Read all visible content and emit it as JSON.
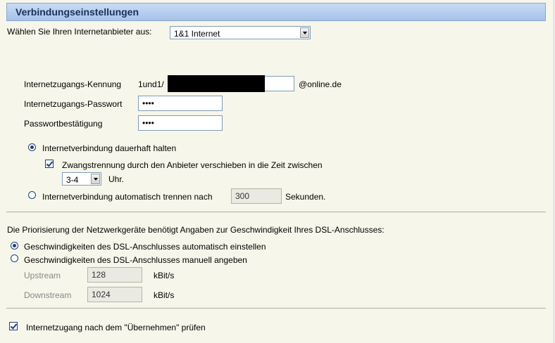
{
  "section": {
    "title": "Verbindungseinstellungen"
  },
  "provider": {
    "label": "Wählen Sie Ihren Internetanbieter aus:",
    "selected": "1&1 Internet"
  },
  "account": {
    "kennung_label": "Internetzugangs-Kennung",
    "kennung_prefix": "1und1/",
    "kennung_suffix": "@online.de",
    "passwort_label": "Internetzugangs-Passwort",
    "passwort_value": "••••",
    "bestaetigung_label": "Passwortbestätigung",
    "bestaetigung_value": "••••"
  },
  "connection": {
    "keep_label": "Internetverbindung dauerhaft halten",
    "shift_label": "Zwangstrennung durch den Anbieter verschieben in die Zeit zwischen",
    "shift_time": "3-4",
    "shift_unit": "Uhr.",
    "auto_label": "Internetverbindung automatisch trennen nach",
    "auto_value": "300",
    "auto_unit": "Sekunden."
  },
  "dsl": {
    "intro": "Die Priorisierung der Netzwerkgeräte benötigt Angaben zur Geschwindigkeit Ihres DSL-Anschlusses:",
    "auto_label": "Geschwindigkeiten des DSL-Anschlusses automatisch einstellen",
    "manual_label": "Geschwindigkeiten des DSL-Anschlusses manuell angeben",
    "upstream_label": "Upstream",
    "upstream_value": "128",
    "upstream_unit": "kBit/s",
    "downstream_label": "Downstream",
    "downstream_value": "1024",
    "downstream_unit": "kBit/s"
  },
  "check": {
    "label": "Internetzugang nach dem \"Übernehmen\" prüfen"
  }
}
